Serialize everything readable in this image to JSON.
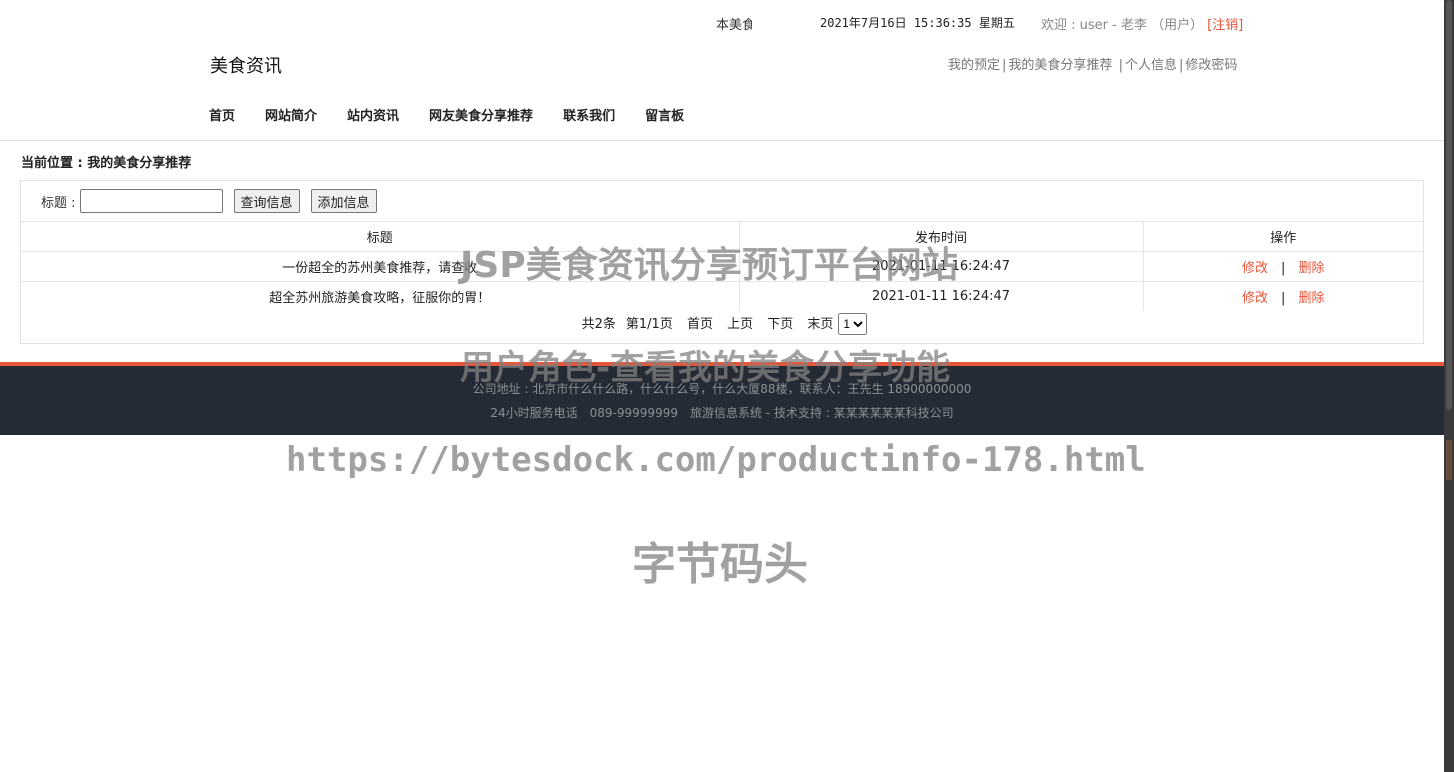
{
  "header": {
    "marquee": "本美食",
    "datetime": "2021年7月16日 15:36:35 星期五",
    "welcome": "欢迎 : user - 老李 （用户）",
    "logout": "[注销]",
    "brand": "美食资讯",
    "user_links": [
      "我的预定",
      "我的美食分享推荐",
      "个人信息",
      "修改密码"
    ]
  },
  "nav": [
    "首页",
    "网站简介",
    "站内资讯",
    "网友美食分享推荐",
    "联系我们",
    "留言板"
  ],
  "breadcrumb": "当前位置 : 我的美食分享推荐",
  "search": {
    "label": "标题 :",
    "value": "",
    "query_button": "查询信息",
    "add_button": "添加信息"
  },
  "table": {
    "headers": [
      "标题",
      "发布时间",
      "操作"
    ],
    "rows": [
      {
        "title": "一份超全的苏州美食推荐，请查收",
        "time": "2021-01-11 16:24:47",
        "edit": "修改",
        "delete": "删除"
      },
      {
        "title": "超全苏州旅游美食攻略，征服你的胃！",
        "time": "2021-01-11 16:24:47",
        "edit": "修改",
        "delete": "删除"
      }
    ],
    "separator": "|"
  },
  "pager": {
    "total": "共2条",
    "page": "第1/1页",
    "first": "首页",
    "prev": "上页",
    "next": "下页",
    "last": "末页",
    "selected": "1"
  },
  "footer": {
    "line1": "公司地址 : 北京市什么什么路，什么什么号，什么大厦88楼，联系人：王先生 18900000000",
    "line2": "24小时服务电话　089-99999999　旅游信息系统 - 技术支持 : 某某某某某某科技公司"
  },
  "watermarks": [
    "JSP美食资讯分享预订平台网站",
    "用户角色-查看我的美食分享功能",
    "https://bytesdock.com/productinfo-178.html",
    "字节码头"
  ],
  "colors": {
    "accent": "#e8553a",
    "footer_bg": "#252b34"
  }
}
